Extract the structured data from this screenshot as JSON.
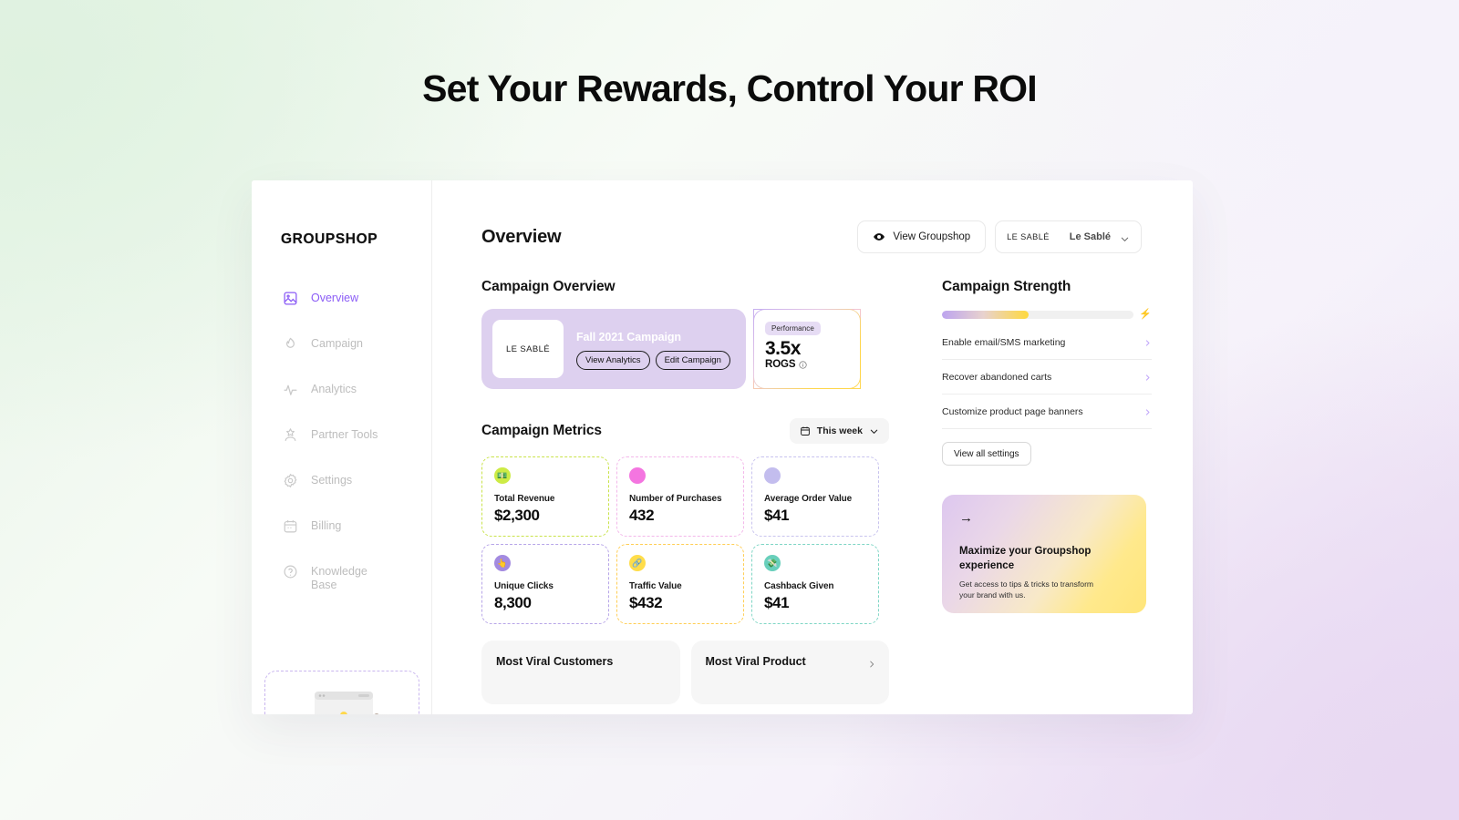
{
  "page": {
    "heading": "Set Your Rewards, Control Your ROI"
  },
  "sidebar": {
    "logo": "GROUPSHOP",
    "items": [
      {
        "label": "Overview",
        "icon": "image-icon",
        "active": true
      },
      {
        "label": "Campaign",
        "icon": "flame-icon",
        "active": false
      },
      {
        "label": "Analytics",
        "icon": "pulse-icon",
        "active": false
      },
      {
        "label": "Partner Tools",
        "icon": "star-person-icon",
        "active": false
      },
      {
        "label": "Settings",
        "icon": "gear-icon",
        "active": false
      },
      {
        "label": "Billing",
        "icon": "calendar-icon",
        "active": false
      },
      {
        "label": "Knowledge Base",
        "icon": "question-icon",
        "active": false
      }
    ]
  },
  "topbar": {
    "title": "Overview",
    "view_groupshop_label": "View Groupshop",
    "brand_logo": "LE SABLÉ",
    "brand_name": "Le Sablé"
  },
  "campaign_overview": {
    "section_title": "Campaign Overview",
    "thumb_label": "LE SABLÉ",
    "campaign_name": "Fall 2021 Campaign",
    "view_analytics_label": "View Analytics",
    "edit_campaign_label": "Edit Campaign",
    "performance_badge": "Performance",
    "performance_value": "3.5x",
    "performance_label": "ROGS"
  },
  "campaign_metrics": {
    "section_title": "Campaign Metrics",
    "date_range": "This week",
    "cards": [
      {
        "label": "Total Revenue",
        "value": "$2,300",
        "emoji": "💵",
        "icon_bg": "#cdeb45",
        "border": "#c9e34a"
      },
      {
        "label": "Number of Purchases",
        "value": "432",
        "emoji": "",
        "icon_bg": "#f475e0",
        "border": "#f3b8ea"
      },
      {
        "label": "Average Order Value",
        "value": "$41",
        "emoji": "",
        "icon_bg": "#c3bdee",
        "border": "#c8c3ee"
      },
      {
        "label": "Unique Clicks",
        "value": "8,300",
        "emoji": "👆",
        "icon_bg": "#a38ae0",
        "border": "#b7a5e8"
      },
      {
        "label": "Traffic Value",
        "value": "$432",
        "emoji": "🔗",
        "icon_bg": "#ffdd4a",
        "border": "#ffce54"
      },
      {
        "label": "Cashback Given",
        "value": "$41",
        "emoji": "💸",
        "icon_bg": "#68cfbb",
        "border": "#7fd6c5"
      }
    ]
  },
  "viral_cards": [
    {
      "title": "Most Viral Customers"
    },
    {
      "title": "Most Viral Product"
    }
  ],
  "campaign_strength": {
    "section_title": "Campaign Strength",
    "progress_percent": 45,
    "bolt_icon": "⚡",
    "items": [
      {
        "label": "Enable email/SMS marketing"
      },
      {
        "label": "Recover abandoned carts"
      },
      {
        "label": "Customize product page banners"
      }
    ],
    "view_all_label": "View all settings"
  },
  "promo": {
    "arrow": "→",
    "title": "Maximize your Groupshop experience",
    "subtitle": "Get access to tips & tricks to transform your brand with us."
  },
  "colors": {
    "accent_purple": "#8b5cf6",
    "campaign_card_bg": "#ddd0ef",
    "progress_start": "#bda4ef",
    "progress_end": "#ffd93d"
  }
}
